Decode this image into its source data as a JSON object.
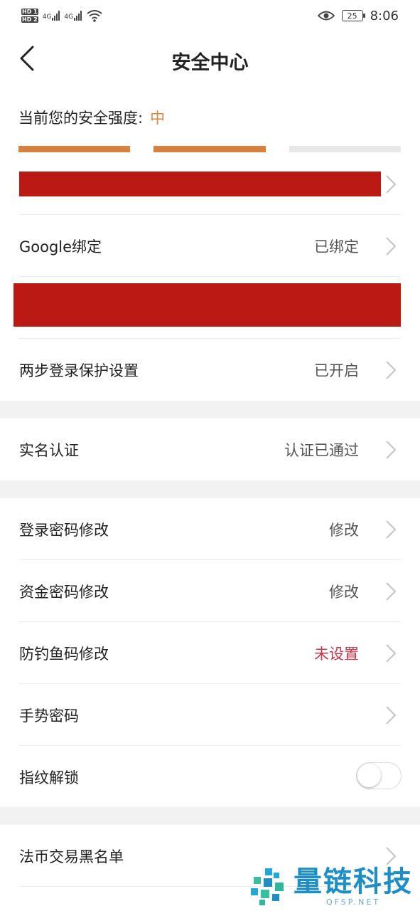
{
  "status_bar": {
    "time": "8:06",
    "battery": "25",
    "network_1": "4G",
    "network_2": "4G",
    "hd_1": "HD 1",
    "hd_2": "HD 2"
  },
  "nav": {
    "title": "安全中心"
  },
  "security": {
    "label": "当前您的安全强度:",
    "level": "中",
    "strength_filled_segments": 2,
    "strength_total_segments": 3,
    "color_filled": "#d9823f",
    "color_empty": "#e8e8e8"
  },
  "rows": {
    "google": {
      "label": "Google绑定",
      "value": "已绑定"
    },
    "two_step": {
      "label": "两步登录保护设置",
      "value": "已开启"
    },
    "real_name": {
      "label": "实名认证",
      "value": "认证已通过"
    },
    "login_pwd": {
      "label": "登录密码修改",
      "value": "修改"
    },
    "fund_pwd": {
      "label": "资金密码修改",
      "value": "修改"
    },
    "anti_phishing": {
      "label": "防钓鱼码修改",
      "value": "未设置"
    },
    "gesture": {
      "label": "手势密码"
    },
    "fingerprint": {
      "label": "指纹解锁",
      "enabled": false
    },
    "blacklist": {
      "label": "法币交易黑名单"
    }
  },
  "watermark": {
    "main": "量链科技",
    "sub": "QFSP.NET"
  },
  "colors": {
    "redaction": "#bb1a14",
    "accent_orange": "#d98741",
    "warning_red": "#c9374b",
    "watermark_blue": "#1e8ec4"
  }
}
